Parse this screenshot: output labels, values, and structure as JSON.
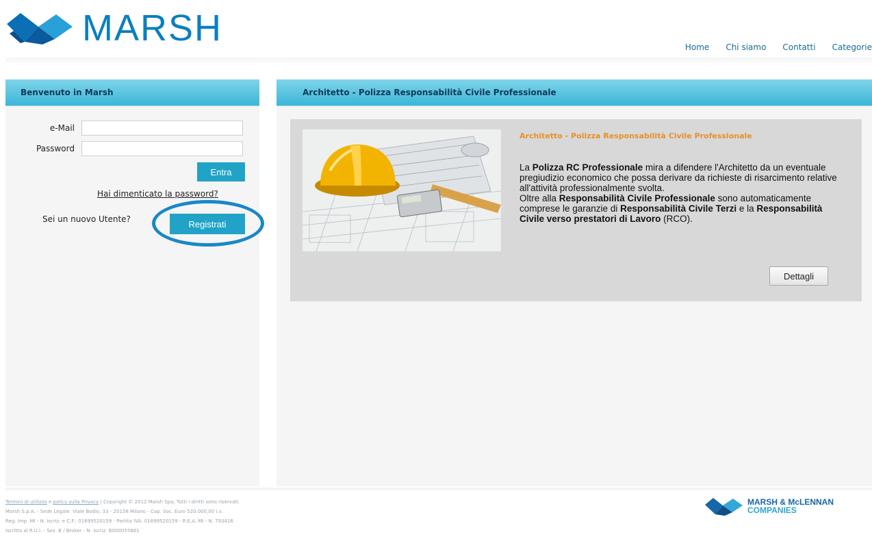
{
  "header": {
    "logo_text": "MARSH",
    "logo_icon": "marsh-bird-icon",
    "nav": [
      {
        "label": "Home"
      },
      {
        "label": "Chi siamo"
      },
      {
        "label": "Contatti"
      },
      {
        "label": "Categorie"
      }
    ]
  },
  "login": {
    "title": "Benvenuto in Marsh",
    "email_label": "e-Mail",
    "email_value": "",
    "password_label": "Password",
    "password_value": "",
    "enter_button": "Entra",
    "forgot_link": "Hai dimenticato la password?",
    "new_user_label": "Sei un nuovo Utente?",
    "register_button": "Registrati"
  },
  "product": {
    "header": "Architetto - Polizza Responsabilità Civile Professionale",
    "title": "Architetto - Polizza Responsabilità Civile Professionale",
    "p1_pre": "La ",
    "p1_bold": "Polizza RC Professionale",
    "p1_post": " mira a difendere l'Architetto da un eventuale pregiudizio economico che possa derivare da richieste di risarcimento relative all'attività professionalmente svolta.",
    "p2_pre": "Oltre alla ",
    "p2_bold1": "Responsabilità Civile Professionale",
    "p2_mid1": " sono automaticamente comprese le garanzie di ",
    "p2_bold2": "Responsabilità Civile Terzi",
    "p2_mid2": " e la ",
    "p2_bold3": "Responsabilità Civile verso prestatori di Lavoro",
    "p2_post": " (RCO).",
    "details_button": "Dettagli",
    "image": "hard-hat-blueprints-calculator"
  },
  "footer": {
    "terms_link": "Termini di utilizzo",
    "privacy_link": "policy sulla Privacy",
    "line1_tail": " | Copyright © 2012 Marsh Spa; Tutti i diritti sono riservati.",
    "line2": "Marsh S.p.A. - Sede Legale: Viale Bodio, 33 - 20158 Milano - Cap. Soc. Euro 520.000,00 i.v.",
    "line3": "Reg. Imp. MI - N. Iscriz. e C.F.: 01699520159 - Partita IVA: 01699520159 - R.E.A. MI - N. 793416",
    "line4": "Iscritta al R.U.I. - Sez. B / Broker - N. Iscriz. B000055861",
    "mmc_line1": "MARSH & McLENNAN",
    "mmc_line2": "COMPANIES",
    "mmc_icon": "mmc-bird-icon"
  },
  "colors": {
    "brand_blue": "#0a7fc0",
    "button_blue": "#21a3c8",
    "header_band": "#4cc0de",
    "title_orange": "#e8902a",
    "highlight_ring": "#1888c8"
  }
}
